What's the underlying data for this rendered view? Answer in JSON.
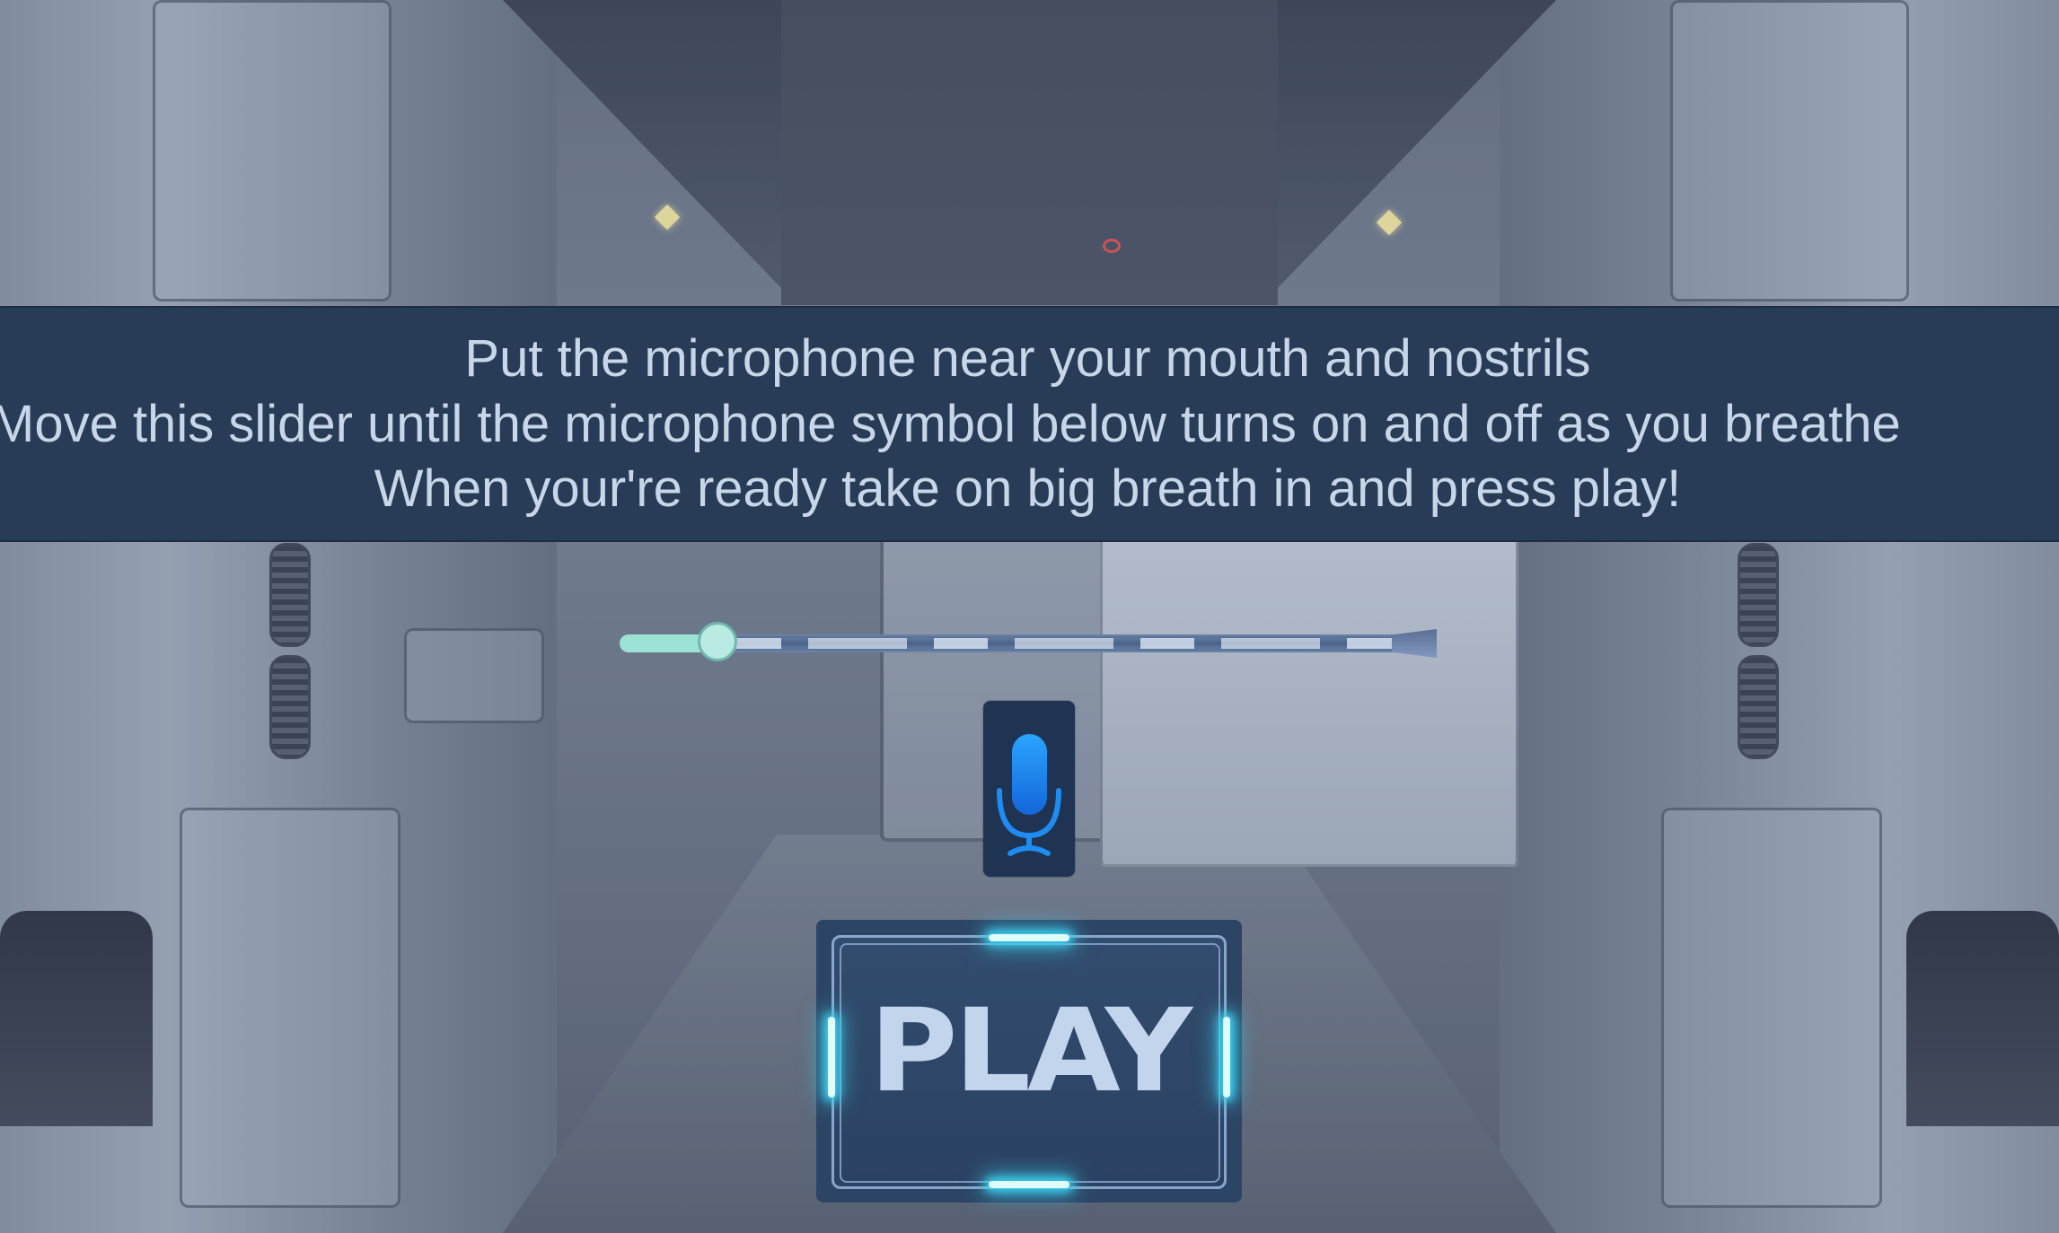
{
  "instructions": {
    "line1": "Put the microphone near your mouth and nostrils",
    "line2": "Move this slider until the microphone symbol below turns on and off as you breathe",
    "line3": "When your're ready take on big breath in and press play!"
  },
  "sensitivity_slider": {
    "value_fraction": 0.09
  },
  "microphone_indicator": {
    "icon": "microphone-icon",
    "state": "on",
    "color": "#1e8cf0"
  },
  "play_button": {
    "label": "PLAY",
    "glow_color": "#3cd4f2"
  },
  "colors": {
    "banner": "#283c57",
    "banner_text": "#c7d6e8",
    "slider_fill": "#9ce3d6",
    "play_text": "#c3d5ed"
  }
}
